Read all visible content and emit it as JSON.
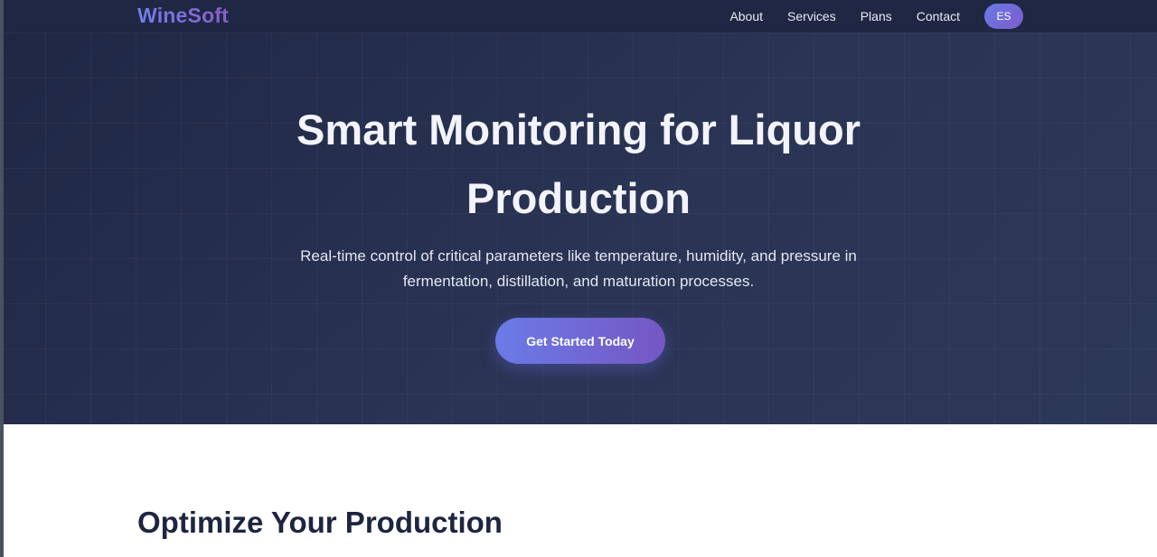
{
  "nav": {
    "brand": "WineSoft",
    "links": [
      "About",
      "Services",
      "Plans",
      "Contact"
    ],
    "lang_button": "ES"
  },
  "hero": {
    "title_line1": "Smart Monitoring for Liquor",
    "title_line2": "Production",
    "subtitle_line1": "Real-time control of critical parameters like temperature, humidity, and pressure in",
    "subtitle_line2": "fermentation, distillation, and maturation processes.",
    "cta_label": "Get Started Today"
  },
  "section": {
    "title": "Optimize Your Production"
  },
  "colors": {
    "nav_bg": "#1f2744",
    "hero_bg": "#26304d",
    "accent_start": "#6b7be7",
    "accent_end": "#7557c4",
    "section_title": "#1d2540"
  }
}
